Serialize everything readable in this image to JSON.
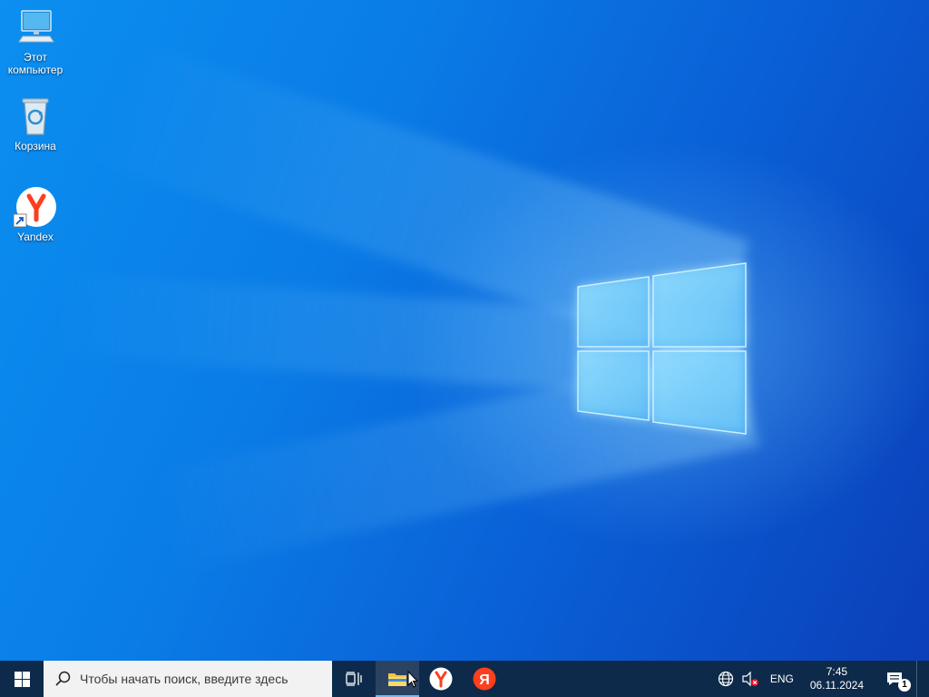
{
  "desktop": {
    "icons": [
      {
        "name": "this-pc",
        "label": "Этот\nкомпьютер",
        "icon": "computer-icon"
      },
      {
        "name": "recycle-bin",
        "label": "Корзина",
        "icon": "recycle-bin-icon"
      },
      {
        "name": "yandex",
        "label": "Yandex",
        "icon": "yandex-browser-icon"
      }
    ],
    "wallpaper": "windows-10-hero"
  },
  "taskbar": {
    "start_icon": "windows-logo-icon",
    "search_placeholder": "Чтобы начать поиск, введите здесь",
    "task_view_icon": "task-view-icon",
    "pinned_apps": [
      {
        "name": "file-explorer",
        "icon": "folder-icon",
        "active": true
      },
      {
        "name": "yandex-browser",
        "icon": "yandex-browser-icon",
        "active": false
      },
      {
        "name": "yandex",
        "icon": "yandex-letter-icon",
        "active": false
      }
    ],
    "tray": {
      "network_icon": "globe-icon",
      "volume_icon": "speaker-muted-icon",
      "language": "ENG",
      "time": "7:45",
      "date": "06.11.2024",
      "notifications_icon": "action-center-icon",
      "notifications_count": "1"
    }
  },
  "colors": {
    "taskbar": "#0e2a4a",
    "desktop_blue": "#0a7ce6",
    "yandex_red": "#fc3f1d"
  }
}
